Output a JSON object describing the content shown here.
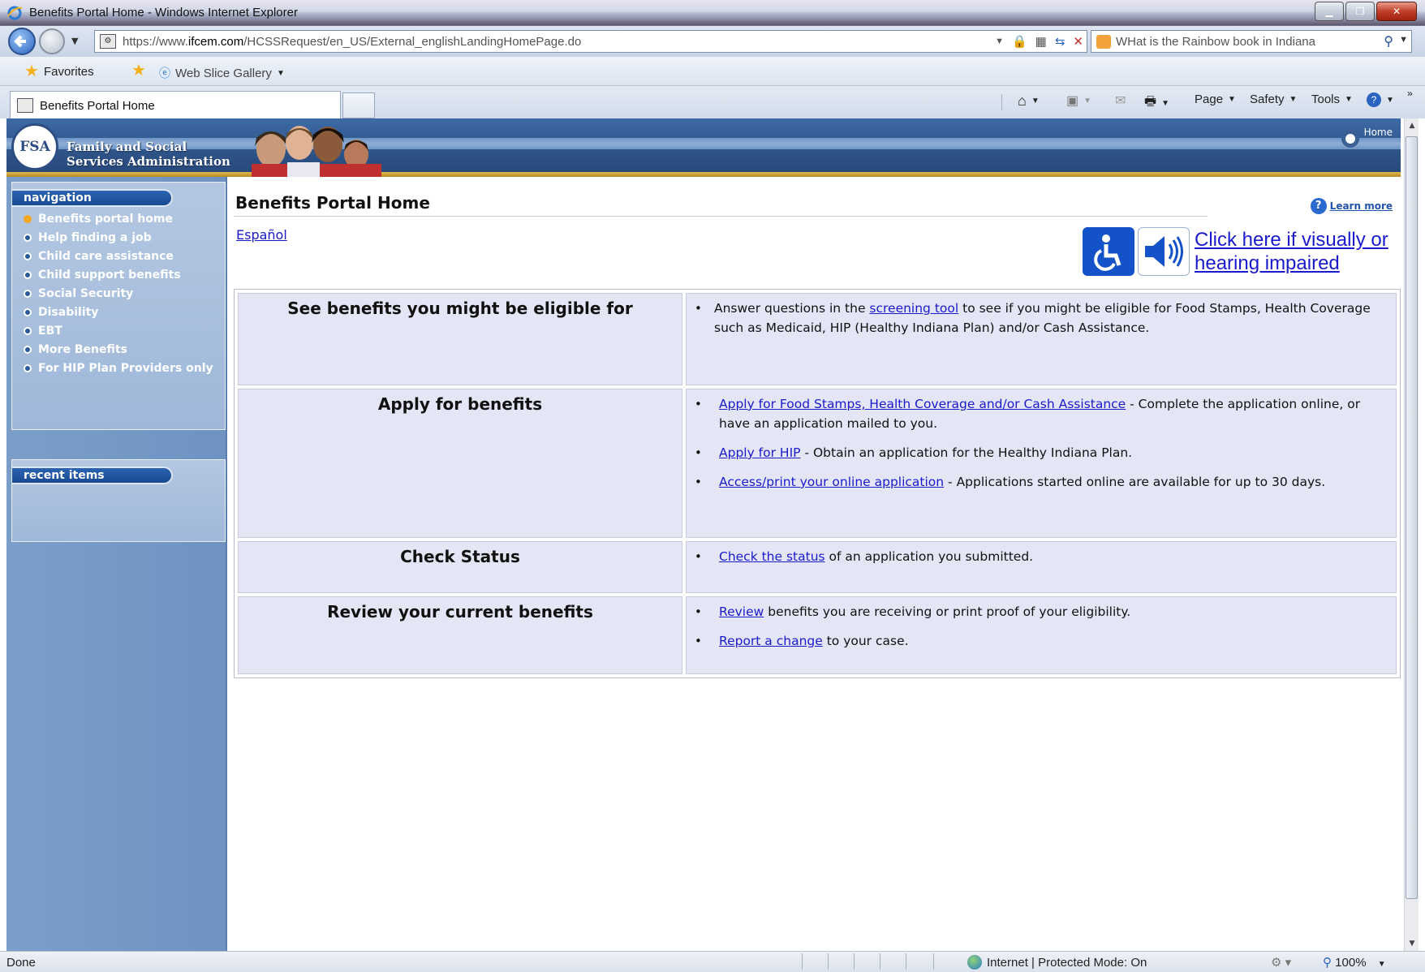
{
  "window": {
    "title": "Benefits Portal Home - Windows Internet Explorer"
  },
  "address": {
    "url_prefix": "https://www.",
    "url_domain": "ifcem.com",
    "url_path": "/HCSSRequest/en_US/External_englishLandingHomePage.do",
    "search_text": "WHat is the Rainbow book in Indiana"
  },
  "favorites": {
    "favorites_label": "Favorites",
    "web_slice_label": "Web Slice Gallery"
  },
  "tab": {
    "label": "Benefits Portal Home"
  },
  "commands": {
    "page": "Page",
    "safety": "Safety",
    "tools": "Tools"
  },
  "header": {
    "seal_text": "FSA",
    "org_line1": "Family and Social",
    "org_line2": "Services Administration",
    "home_label": "Home"
  },
  "sidebar": {
    "nav_title": "navigation",
    "items": [
      {
        "label": "Benefits portal home",
        "active": true
      },
      {
        "label": "Help finding a job"
      },
      {
        "label": "Child care assistance"
      },
      {
        "label": "Child support benefits"
      },
      {
        "label": "Social Security"
      },
      {
        "label": "Disability"
      },
      {
        "label": "EBT"
      },
      {
        "label": "More Benefits"
      },
      {
        "label": "For HIP Plan Providers only"
      }
    ],
    "recent_title": "recent items"
  },
  "main": {
    "title": "Benefits Portal Home",
    "learn_more": "Learn more",
    "espanol": "Español",
    "access_text": "Click here if visually or hearing impaired",
    "rows": [
      {
        "heading": "See benefits you might be eligible for",
        "text_before": "Answer questions in the ",
        "link": "screening tool",
        "text_after": " to see if you might be eligible for Food Stamps, Health Coverage such as Medicaid, HIP (Healthy Indiana Plan) and/or Cash Assistance."
      },
      {
        "heading": "Apply for benefits",
        "items": [
          {
            "link": "Apply for Food Stamps, Health Coverage and/or Cash Assistance",
            "text": " - Complete the application online, or have an application mailed to you."
          },
          {
            "link": "Apply for HIP",
            "text": " - Obtain an application for the Healthy Indiana Plan."
          },
          {
            "link": "Access/print your online application",
            "text": " - Applications started online are available for up to 30 days."
          }
        ]
      },
      {
        "heading": "Check Status",
        "items": [
          {
            "link": "Check the status",
            "text": " of an application you submitted."
          }
        ]
      },
      {
        "heading": "Review your current benefits",
        "items": [
          {
            "link": "Review",
            "text": " benefits you are receiving or print proof of your eligibility."
          },
          {
            "link": "Report a change",
            "text": " to your case."
          }
        ]
      }
    ]
  },
  "status": {
    "text": "Done",
    "zone": "Internet | Protected Mode: On",
    "zoom": "100%"
  }
}
